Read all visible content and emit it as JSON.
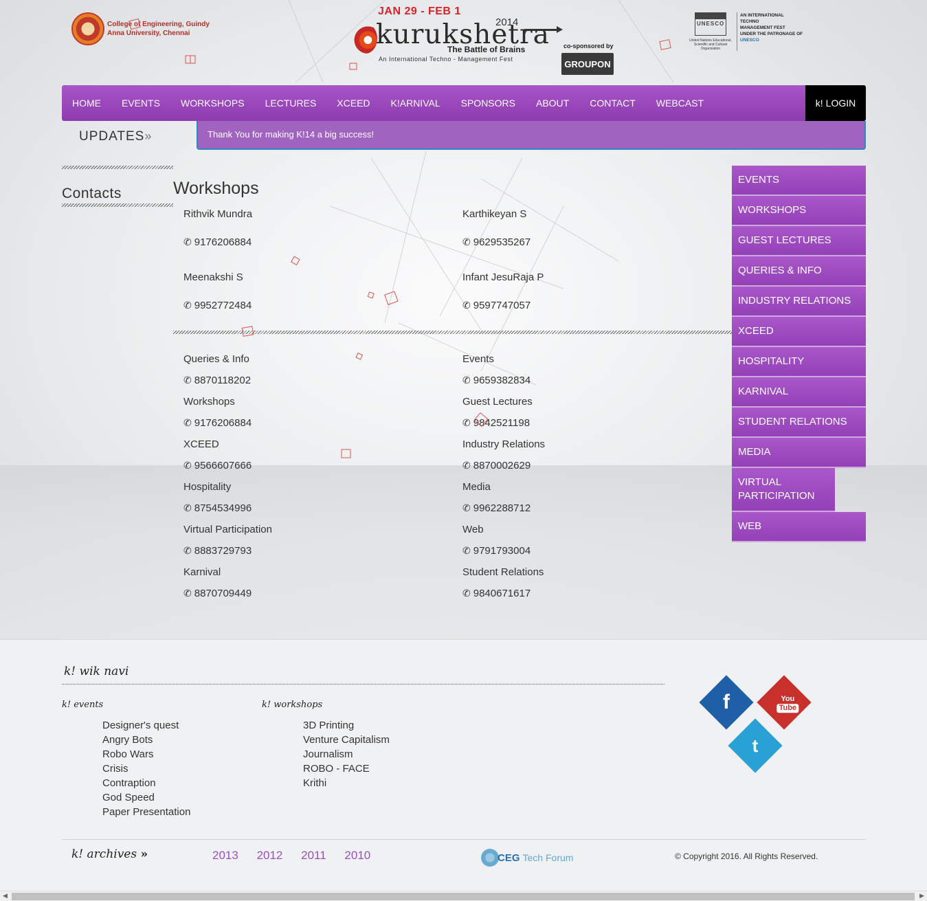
{
  "header": {
    "college_line1": "College of Engineering, Guindy",
    "college_line2": "Anna University, Chennai",
    "dates": "JAN 29 - FEB 1",
    "year": "2014",
    "brand_name": "kurukshetra",
    "tagline": "The Battle of Brains",
    "subtitle": "An International Techno - Management Fest",
    "cosponsor_label": "co-sponsored by",
    "sponsor_name": "GROUPON",
    "unesco_line1": "AN INTERNATIONAL",
    "unesco_line2": "TECHNO",
    "unesco_line3": "MANAGEMENT FEST",
    "unesco_line4": "UNDER THE PATRONAGE OF",
    "unesco_line5": "UNESCO",
    "unesco_org": "United Nations Educational, Scientific and Cultural Organization"
  },
  "nav": {
    "items": [
      "HOME",
      "EVENTS",
      "WORKSHOPS",
      "LECTURES",
      "XCEED",
      "K!ARNIVAL",
      "SPONSORS",
      "ABOUT",
      "CONTACT",
      "WEBCAST"
    ],
    "login_icon": "k!",
    "login": "LOGIN"
  },
  "updates": {
    "label": "UPDATES",
    "message": "Thank You for making K!14 a big success!"
  },
  "contacts": {
    "heading": "Contacts",
    "section_title": "Workshops",
    "workshop_people": [
      {
        "name": "Rithvik Mundra",
        "phone": "9176206884"
      },
      {
        "name": "Karthikeyan S",
        "phone": "9629535267"
      },
      {
        "name": "Meenakshi S",
        "phone": "9952772484"
      },
      {
        "name": "Infant JesuRaja P",
        "phone": "9597747057"
      }
    ],
    "departments": [
      {
        "name": "Queries & Info",
        "phone": "8870118202"
      },
      {
        "name": "Events",
        "phone": "9659382834"
      },
      {
        "name": "Workshops",
        "phone": "9176206884"
      },
      {
        "name": "Guest Lectures",
        "phone": "9842521198"
      },
      {
        "name": "XCEED",
        "phone": "9566607666"
      },
      {
        "name": "Industry Relations",
        "phone": "8870002629"
      },
      {
        "name": "Hospitality",
        "phone": "8754534996"
      },
      {
        "name": "Media",
        "phone": "9962288712"
      },
      {
        "name": "Virtual Participation",
        "phone": "8883729793"
      },
      {
        "name": "Web",
        "phone": "9791793004"
      },
      {
        "name": "Karnival",
        "phone": "8870709449"
      },
      {
        "name": "Student Relations",
        "phone": "9840671617"
      }
    ]
  },
  "sidebar": {
    "items": [
      "EVENTS",
      "WORKSHOPS",
      "GUEST LECTURES",
      "QUERIES & INFO",
      "INDUSTRY RELATIONS",
      "XCEED",
      "HOSPITALITY",
      "KARNIVAL",
      "STUDENT RELATIONS",
      "MEDIA",
      "VIRTUAL PARTICIPATION",
      "WEB"
    ]
  },
  "footer": {
    "title": "k! wik navi",
    "events_title": "k! events",
    "events": [
      "Designer's quest",
      "Angry Bots",
      "Robo Wars",
      "Crisis",
      "Contraption",
      "God Speed",
      "Paper Presentation"
    ],
    "workshops_title": "k! workshops",
    "workshops": [
      "3D Printing",
      "Venture Capitalism",
      "Journalism",
      "ROBO - FACE",
      "Krithi"
    ],
    "archives": "k! archives",
    "archive_arrows": "»",
    "years": [
      "2013",
      "2012",
      "2011",
      "2010"
    ],
    "forum_name": "CEG",
    "forum_suffix": "Tech Forum",
    "copyright": "© Copyright 2016. All Rights Reserved.",
    "social": {
      "facebook": "f",
      "youtube_top": "You",
      "youtube_bottom": "Tube",
      "twitter": "t"
    }
  },
  "colors": {
    "accent": "#9a4fbf",
    "nav": "#9a48bd",
    "ticker_border": "#2f86c4",
    "facebook": "#1f5fa8",
    "youtube": "#c8302c",
    "twitter": "#2aa1d4"
  }
}
